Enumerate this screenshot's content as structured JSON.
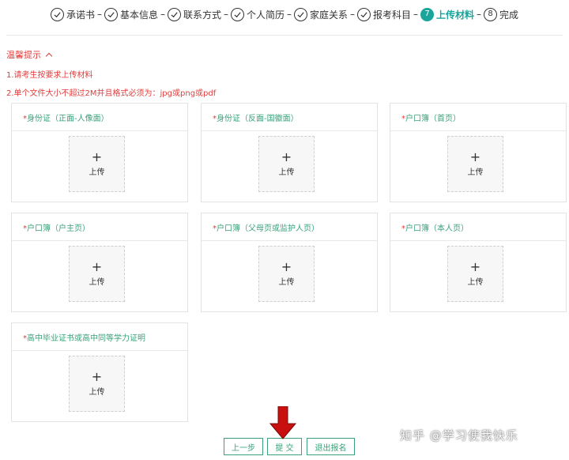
{
  "stepper": {
    "steps": [
      {
        "label": "承诺书",
        "state": "done",
        "number": ""
      },
      {
        "label": "基本信息",
        "state": "done",
        "number": ""
      },
      {
        "label": "联系方式",
        "state": "done",
        "number": ""
      },
      {
        "label": "个人简历",
        "state": "done",
        "number": ""
      },
      {
        "label": "家庭关系",
        "state": "done",
        "number": ""
      },
      {
        "label": "报考科目",
        "state": "done",
        "number": ""
      },
      {
        "label": "上传材料",
        "state": "active",
        "number": "7"
      },
      {
        "label": "完成",
        "state": "pending",
        "number": "8"
      }
    ],
    "separator": "–",
    "active_color": "#1aa59a"
  },
  "tips": {
    "title": "温馨提示",
    "line1": "1.请考生按要求上传材料",
    "line2": "2.单个文件大小不超过2M并且格式必须为：jpg或png或pdf",
    "color": "#e23c3c"
  },
  "upload": {
    "required_mark": "*",
    "plus": "+",
    "button_text": "上传",
    "cards": [
      {
        "title": "身份证（正面-人像面）"
      },
      {
        "title": "身份证（反面-国徽面）"
      },
      {
        "title": "户口簿（首页）"
      },
      {
        "title": "户口簿（户主页）"
      },
      {
        "title": "户口簿（父母页或监护人页）"
      },
      {
        "title": "户口簿（本人页）"
      },
      {
        "title": "高中毕业证书或高中同等学力证明"
      }
    ]
  },
  "buttons": {
    "prev": "上一步",
    "submit": "提 交",
    "exit": "退出报名"
  },
  "watermark": "知乎 @学习使我快乐",
  "colors": {
    "accent_green": "#3aa17a",
    "arrow_red": "#c8100f"
  }
}
